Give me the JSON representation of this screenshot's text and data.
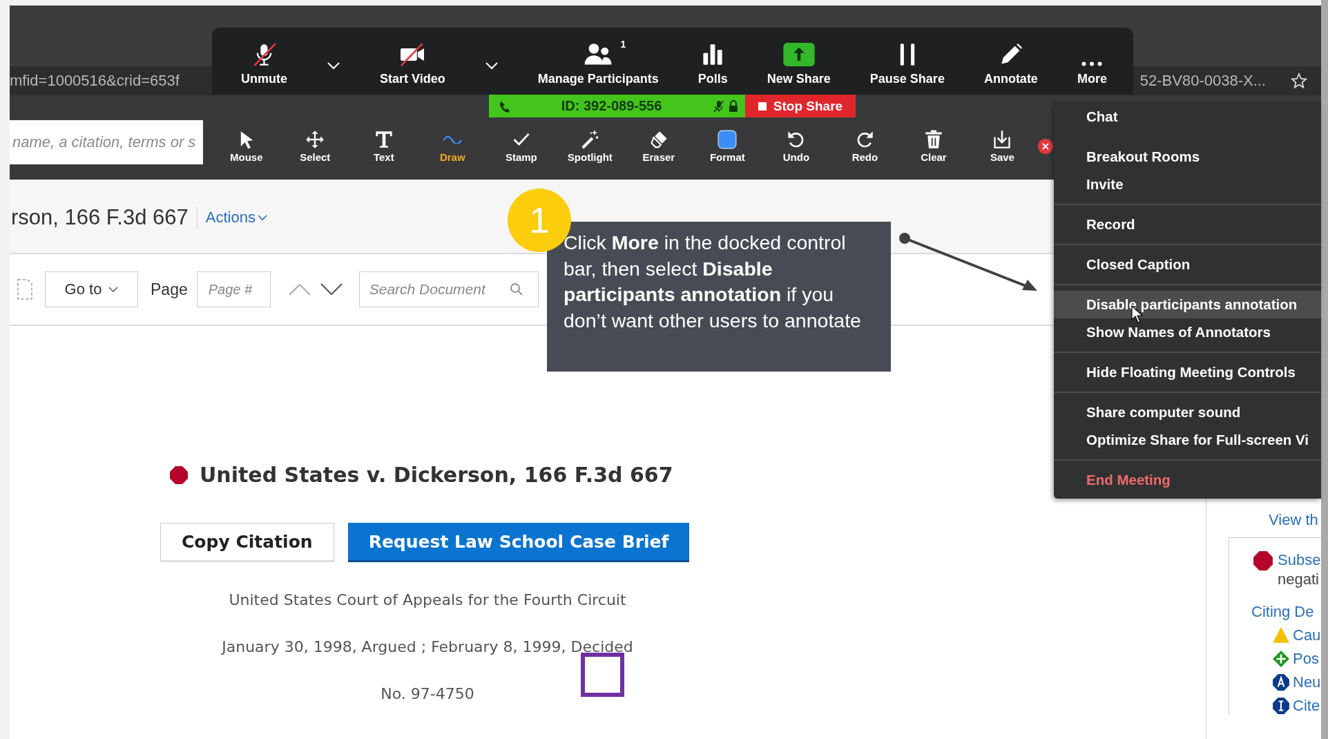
{
  "browser": {
    "url_left": "mfid=1000516&crid=653f",
    "url_right": "52-BV80-0038-X...",
    "search_placeholder": "name, a citation, terms or s"
  },
  "meeting_controls": [
    {
      "kind": "mic",
      "label": "Unmute",
      "off": true,
      "has_menu": true
    },
    {
      "kind": "video",
      "label": "Start Video",
      "off": true,
      "has_menu": true
    },
    {
      "kind": "participants",
      "label": "Manage Participants",
      "count": "1"
    },
    {
      "kind": "polls",
      "label": "Polls"
    },
    {
      "kind": "share",
      "label": "New Share"
    },
    {
      "kind": "pause",
      "label": "Pause Share"
    },
    {
      "kind": "annotate",
      "label": "Annotate"
    },
    {
      "kind": "more",
      "label": "More"
    }
  ],
  "meeting_status": {
    "id": "ID: 392-089-556",
    "stop_label": "Stop Share"
  },
  "annotation_tools": [
    {
      "kind": "mouse",
      "label": "Mouse",
      "selected": false
    },
    {
      "kind": "select",
      "label": "Select",
      "selected": false
    },
    {
      "kind": "text",
      "label": "Text",
      "selected": false
    },
    {
      "kind": "draw",
      "label": "Draw",
      "selected": true
    },
    {
      "kind": "stamp",
      "label": "Stamp",
      "selected": false
    },
    {
      "kind": "spotlight",
      "label": "Spotlight",
      "selected": false
    },
    {
      "kind": "eraser",
      "label": "Eraser",
      "selected": false
    },
    {
      "kind": "format",
      "label": "Format",
      "selected": false
    },
    {
      "kind": "undo",
      "label": "Undo",
      "selected": false
    },
    {
      "kind": "redo",
      "label": "Redo",
      "selected": false
    },
    {
      "kind": "clear",
      "label": "Clear",
      "selected": false
    },
    {
      "kind": "save",
      "label": "Save",
      "selected": false
    }
  ],
  "page_header": {
    "title": "rson, 166 F.3d 667",
    "actions": "Actions"
  },
  "doc_toolbar": {
    "goto": "Go to",
    "page_label": "Page",
    "page_placeholder": "Page #",
    "search_placeholder": "Search Document"
  },
  "document": {
    "title": "United States v. Dickerson, 166 F.3d 667",
    "buttons": [
      {
        "kind": "secondary",
        "label": "Copy Citation"
      },
      {
        "kind": "primary",
        "label": "Request Law School Case Brief"
      }
    ],
    "lines": [
      "United States Court of Appeals for the Fourth Circuit",
      "January 30, 1998, Argued ; February 8, 1999, Decided",
      "No. 97-4750"
    ]
  },
  "side_panel": {
    "link": "View th",
    "entry": {
      "title": "Subse",
      "note": "negati"
    },
    "heading": "Citing De",
    "signals": [
      {
        "kind": "caution",
        "label": "Cau"
      },
      {
        "kind": "positive",
        "label": "Pos"
      },
      {
        "kind": "neutral",
        "label": "Neu"
      },
      {
        "kind": "cited",
        "label": "Cite"
      }
    ]
  },
  "more_menu": [
    {
      "label": "Chat",
      "kind": "normal",
      "selected": false,
      "divider_after": false
    },
    {
      "label": "Breakout Rooms",
      "kind": "normal",
      "selected": false,
      "divider_after": false
    },
    {
      "label": "Invite",
      "kind": "normal",
      "selected": false,
      "divider_after": true
    },
    {
      "label": "Record",
      "kind": "normal",
      "selected": false,
      "divider_after": true
    },
    {
      "label": "Closed Caption",
      "kind": "normal",
      "selected": false,
      "divider_after": true
    },
    {
      "label": "Disable participants annotation",
      "kind": "normal",
      "selected": true,
      "divider_after": false
    },
    {
      "label": "Show Names of Annotators",
      "kind": "normal",
      "selected": false,
      "divider_after": true
    },
    {
      "label": "Hide Floating Meeting Controls",
      "kind": "normal",
      "selected": false,
      "divider_after": true
    },
    {
      "label": "Share computer sound",
      "kind": "normal",
      "selected": false,
      "divider_after": false
    },
    {
      "label": "Optimize Share for Full-screen Vi",
      "kind": "normal",
      "selected": false,
      "divider_after": true
    },
    {
      "label": "End Meeting",
      "kind": "danger",
      "selected": false,
      "divider_after": false
    }
  ],
  "callout": {
    "number": "1",
    "text": "Click **More** in the docked control bar, then select **Disable participants annotation** if you don’t want other users to annotate"
  }
}
